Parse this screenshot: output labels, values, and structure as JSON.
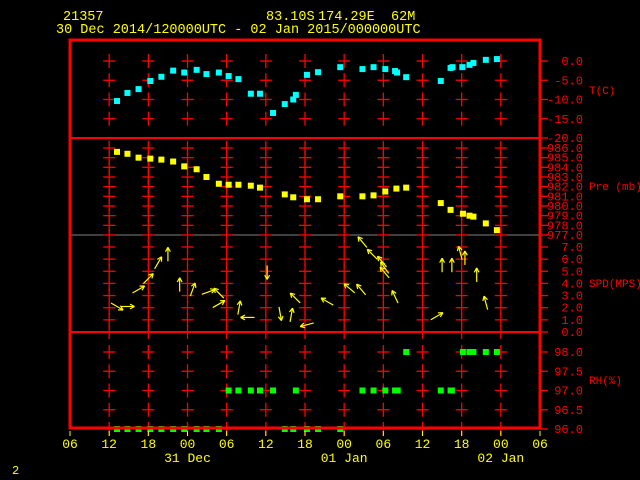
{
  "header": {
    "station_id": "21357",
    "latitude": "83.10S",
    "longitude": "174.29E",
    "elevation": "62M",
    "period": "30 Dec 2014/120000UTC - 02 Jan 2015/000000UTC"
  },
  "page_number": "2",
  "colors": {
    "frame": "#ff0000",
    "temperature": "#00ffff",
    "pressure": "#ffff00",
    "wind": "#ffff00",
    "rh": "#00ff00",
    "text": "#ffff00",
    "divider": "#808080"
  },
  "chart_data": {
    "type": "scatter",
    "time_unit": "hours since 30 Dec 2014 00UTC",
    "xlim": [
      6,
      78
    ],
    "x_ticks": [
      {
        "hour": 6,
        "label": "06"
      },
      {
        "hour": 12,
        "label": "12"
      },
      {
        "hour": 18,
        "label": "18"
      },
      {
        "hour": 24,
        "label": "00"
      },
      {
        "hour": 30,
        "label": "06"
      },
      {
        "hour": 36,
        "label": "12"
      },
      {
        "hour": 42,
        "label": "18"
      },
      {
        "hour": 48,
        "label": "00"
      },
      {
        "hour": 54,
        "label": "06"
      },
      {
        "hour": 60,
        "label": "12"
      },
      {
        "hour": 66,
        "label": "18"
      },
      {
        "hour": 72,
        "label": "00"
      },
      {
        "hour": 78,
        "label": "06"
      }
    ],
    "date_labels": [
      {
        "hour": 24,
        "label": "31 Dec"
      },
      {
        "hour": 48,
        "label": "01 Jan"
      },
      {
        "hour": 72,
        "label": "02 Jan"
      }
    ],
    "panels": [
      {
        "name": "temperature",
        "ylabel": "T(C)",
        "ylim": [
          -20,
          0
        ],
        "ticks": [
          {
            "v": 0,
            "label": "0.0"
          },
          {
            "v": -5,
            "label": "-5.0"
          },
          {
            "v": -10,
            "label": "-10.0"
          },
          {
            "v": -15,
            "label": "-15.0"
          },
          {
            "v": -20,
            "label": "-20.0"
          }
        ],
        "points": [
          [
            13.2,
            -10.4
          ],
          [
            14.8,
            -8.3
          ],
          [
            16.5,
            -7.3
          ],
          [
            18.3,
            -5.2
          ],
          [
            20.0,
            -4.1
          ],
          [
            21.8,
            -2.5
          ],
          [
            23.5,
            -3.0
          ],
          [
            25.4,
            -2.3
          ],
          [
            26.9,
            -3.4
          ],
          [
            28.8,
            -3.0
          ],
          [
            30.3,
            -3.9
          ],
          [
            31.8,
            -4.7
          ],
          [
            33.7,
            -8.5
          ],
          [
            35.1,
            -8.5
          ],
          [
            37.1,
            -13.5
          ],
          [
            38.9,
            -11.2
          ],
          [
            40.2,
            -10.0
          ],
          [
            40.6,
            -8.8
          ],
          [
            42.3,
            -3.6
          ],
          [
            44.0,
            -2.9
          ],
          [
            47.4,
            -1.6
          ],
          [
            50.8,
            -2.1
          ],
          [
            52.5,
            -1.6
          ],
          [
            54.3,
            -2.1
          ],
          [
            55.8,
            -2.6
          ],
          [
            56.1,
            -3.0
          ],
          [
            57.5,
            -4.2
          ],
          [
            62.8,
            -5.2
          ],
          [
            64.3,
            -1.8
          ],
          [
            64.6,
            -1.6
          ],
          [
            66.1,
            -1.6
          ],
          [
            67.2,
            -1.0
          ],
          [
            67.8,
            -0.5
          ],
          [
            69.7,
            0.3
          ],
          [
            71.4,
            0.5
          ]
        ]
      },
      {
        "name": "pressure",
        "ylabel": "Pre (mb)",
        "ylim": [
          977,
          986
        ],
        "ticks": [
          {
            "v": 986,
            "label": "986.0"
          },
          {
            "v": 985,
            "label": "985.0"
          },
          {
            "v": 984,
            "label": "984.0"
          },
          {
            "v": 983,
            "label": "983.0"
          },
          {
            "v": 982,
            "label": "982.0"
          },
          {
            "v": 981,
            "label": "981.0"
          },
          {
            "v": 980,
            "label": "980.0"
          },
          {
            "v": 979,
            "label": "979.0"
          },
          {
            "v": 978,
            "label": "978.0"
          },
          {
            "v": 977,
            "label": "977.0"
          }
        ],
        "points": [
          [
            13.2,
            985.6
          ],
          [
            14.8,
            985.4
          ],
          [
            16.5,
            985.0
          ],
          [
            18.3,
            984.9
          ],
          [
            20.0,
            984.8
          ],
          [
            21.8,
            984.6
          ],
          [
            23.5,
            984.1
          ],
          [
            25.4,
            983.8
          ],
          [
            26.9,
            983.0
          ],
          [
            28.8,
            982.3
          ],
          [
            30.3,
            982.2
          ],
          [
            31.8,
            982.2
          ],
          [
            33.7,
            982.1
          ],
          [
            35.1,
            981.9
          ],
          [
            38.9,
            981.2
          ],
          [
            40.2,
            980.9
          ],
          [
            42.3,
            980.7
          ],
          [
            44.0,
            980.7
          ],
          [
            47.4,
            981.0
          ],
          [
            50.8,
            981.0
          ],
          [
            52.5,
            981.1
          ],
          [
            54.3,
            981.5
          ],
          [
            56.0,
            981.8
          ],
          [
            57.5,
            981.9
          ],
          [
            62.8,
            980.3
          ],
          [
            64.3,
            979.6
          ],
          [
            66.2,
            979.2
          ],
          [
            67.2,
            979.0
          ],
          [
            67.8,
            978.9
          ],
          [
            69.7,
            978.2
          ],
          [
            71.4,
            977.5
          ]
        ]
      },
      {
        "name": "wind",
        "ylabel": "SPD(MPS)",
        "ylim": [
          0,
          7
        ],
        "ticks": [
          {
            "v": 7,
            "label": "7.0"
          },
          {
            "v": 6,
            "label": "6.0"
          },
          {
            "v": 5,
            "label": "5.0"
          },
          {
            "v": 4,
            "label": "4.0"
          },
          {
            "v": 3,
            "label": "3.0"
          },
          {
            "v": 2,
            "label": "2.0"
          },
          {
            "v": 1,
            "label": "1.0"
          },
          {
            "v": 0,
            "label": "0.0"
          }
        ],
        "arrows_note": "speed in m/s; arrow_dir = compass direction the arrow points, degrees",
        "points": [
          [
            13.2,
            2.1,
            120
          ],
          [
            14.8,
            2.1,
            90
          ],
          [
            16.5,
            3.5,
            60
          ],
          [
            18.0,
            4.4,
            45
          ],
          [
            19.5,
            5.7,
            30
          ],
          [
            21.0,
            6.4,
            0
          ],
          [
            22.8,
            3.9,
            0
          ],
          [
            24.8,
            3.5,
            20
          ],
          [
            27.2,
            3.3,
            70
          ],
          [
            28.8,
            3.2,
            315
          ],
          [
            28.8,
            2.3,
            60
          ],
          [
            31.9,
            2.0,
            10
          ],
          [
            33.2,
            1.2,
            270
          ],
          [
            36.2,
            4.9,
            180
          ],
          [
            38.2,
            1.5,
            170
          ],
          [
            39.9,
            1.4,
            10
          ],
          [
            40.5,
            2.8,
            315
          ],
          [
            42.3,
            0.6,
            255
          ],
          [
            45.4,
            2.5,
            300
          ],
          [
            48.8,
            3.6,
            310
          ],
          [
            50.6,
            3.5,
            320
          ],
          [
            50.8,
            7.4,
            320
          ],
          [
            52.3,
            6.4,
            315
          ],
          [
            53.8,
            5.8,
            320
          ],
          [
            54.2,
            5.3,
            325
          ],
          [
            54.2,
            4.9,
            320
          ],
          [
            55.8,
            2.9,
            335
          ],
          [
            62.2,
            1.3,
            60
          ],
          [
            63.0,
            5.5,
            0
          ],
          [
            64.5,
            5.5,
            0
          ],
          [
            65.8,
            6.5,
            345
          ],
          [
            66.5,
            6.1,
            0
          ],
          [
            68.3,
            4.7,
            0
          ],
          [
            69.7,
            2.4,
            345
          ]
        ]
      },
      {
        "name": "relative_humidity",
        "ylabel": "RH(%)",
        "ylim": [
          96,
          98
        ],
        "ticks": [
          {
            "v": 98,
            "label": "98.0"
          },
          {
            "v": 97.5,
            "label": "97.5"
          },
          {
            "v": 97,
            "label": "97.0"
          },
          {
            "v": 96.5,
            "label": "96.5"
          },
          {
            "v": 96,
            "label": "96.0"
          }
        ],
        "points": [
          [
            13.2,
            96
          ],
          [
            14.8,
            96
          ],
          [
            16.5,
            96
          ],
          [
            18.3,
            96
          ],
          [
            20.0,
            96
          ],
          [
            21.8,
            96
          ],
          [
            23.5,
            96
          ],
          [
            25.4,
            96
          ],
          [
            26.9,
            96
          ],
          [
            28.8,
            96
          ],
          [
            30.3,
            97
          ],
          [
            31.8,
            97
          ],
          [
            33.7,
            97
          ],
          [
            35.1,
            97
          ],
          [
            37.1,
            97
          ],
          [
            38.9,
            96
          ],
          [
            40.2,
            96
          ],
          [
            40.6,
            97
          ],
          [
            42.3,
            96
          ],
          [
            44.0,
            96
          ],
          [
            47.4,
            96
          ],
          [
            50.8,
            97
          ],
          [
            52.5,
            97
          ],
          [
            54.3,
            97
          ],
          [
            55.8,
            97
          ],
          [
            56.2,
            97
          ],
          [
            57.5,
            98
          ],
          [
            62.8,
            97
          ],
          [
            64.3,
            97
          ],
          [
            64.5,
            97
          ],
          [
            66.2,
            98
          ],
          [
            67.2,
            98
          ],
          [
            67.8,
            98
          ],
          [
            69.7,
            98
          ],
          [
            71.4,
            98
          ]
        ]
      }
    ]
  }
}
